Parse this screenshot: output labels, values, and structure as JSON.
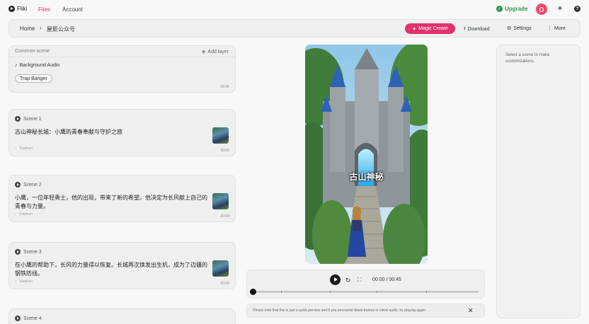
{
  "nav": {
    "brand": "Fliki",
    "files": "Files",
    "account": "Account",
    "upgrade": "Upgrade",
    "accent_color": "#e0336e",
    "upgrade_color": "#2f9a4a"
  },
  "toolbar": {
    "home": "Home",
    "separator": "›",
    "file_name": "屋影公众号",
    "magic_create": "Magic Create",
    "download": "Download",
    "settings": "Settings",
    "more": "More"
  },
  "common_scene": {
    "title": "Common scene",
    "add_layer": "Add layer",
    "audio_label": "Background Audio",
    "audio_track": "Trap Banger",
    "duration": "02:45"
  },
  "scenes": [
    {
      "label": "Scene 1",
      "text": "古山神秘长城：小鹰的青春奉献与守护之旅",
      "voice": "Xiaohan",
      "duration": "00:05"
    },
    {
      "label": "Scene 2",
      "text": "小鹰，一位年轻勇士，他的出现，带来了新的希望。他决定为长风献上自己的青春与力量。",
      "voice": "Xiaohan",
      "duration": "00:09"
    },
    {
      "label": "Scene 3",
      "text": "在小鹰的帮助下，长风的力量得以恢复。长城再次焕发出生机，成为了边疆的钢铁防线。",
      "voice": "Xiaohan",
      "duration": "00:08"
    },
    {
      "label": "Scene 4"
    }
  ],
  "preview": {
    "caption": "古山神秘"
  },
  "player": {
    "time": "00:00 / 00:45",
    "progress": 0
  },
  "notice": {
    "text": "Please note that this is just a quick preview and if you encounter blank frames or silent audio, try playing again",
    "close": "✕"
  },
  "right_panel": {
    "message": "Select a scene to make customizations."
  },
  "icons": {
    "brand": "play-circle-icon",
    "upgrade": "check-circle-icon",
    "theme": "sun-icon",
    "help": "question-icon",
    "add_layer": "layers-icon",
    "audio": "music-note-icon",
    "download": "download-icon",
    "settings": "gear-icon",
    "more": "more-vertical-icon",
    "loop": "replay-icon",
    "fullscreen": "fullscreen-icon"
  }
}
